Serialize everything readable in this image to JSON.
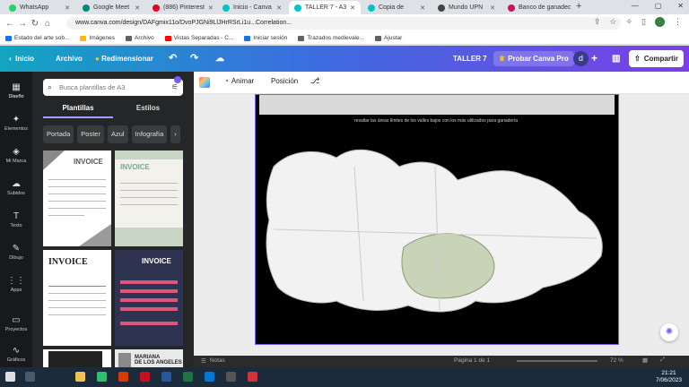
{
  "browser": {
    "tabs": [
      {
        "label": "WhatsApp",
        "color": "#25d366"
      },
      {
        "label": "Google Meet",
        "color": "#00897b"
      },
      {
        "label": "(886) Pinterest",
        "color": "#e60023"
      },
      {
        "label": "Inicio - Canva",
        "color": "#00c4cc"
      },
      {
        "label": "TALLER 7 - A3",
        "color": "#00c4cc"
      },
      {
        "label": "Copia de",
        "color": "#00c4cc"
      },
      {
        "label": "Mundo UPN",
        "color": "#444444"
      },
      {
        "label": "Banco de ganadec",
        "color": "#c2185b"
      }
    ],
    "new_tab": "+",
    "url": "www.canva.com/design/DAFgmix11o/DvoPJGNi9LlJHrRSrLi1u...Correlation...",
    "bookmarks": [
      {
        "label": "Estado del arte sob...",
        "color": "#1a73e8"
      },
      {
        "label": "Imágenes",
        "color": "#fbbc04"
      },
      {
        "label": "Archivo",
        "color": "#5f6368"
      },
      {
        "label": "Vistas Separadas - C...",
        "color": "#ff0000"
      },
      {
        "label": "Iniciar sesión",
        "color": "#1a73e8"
      },
      {
        "label": "Trazados medievale...",
        "color": "#5f6368"
      },
      {
        "label": "Ajustar",
        "color": "#5f6368"
      }
    ]
  },
  "canva": {
    "header": {
      "home": "Inicio",
      "file": "Archivo",
      "resize": "Redimensionar",
      "doc_title": "TALLER 7",
      "upgrade": "Probar Canva Pro",
      "avatar_letter": "d",
      "share": "Compartir"
    },
    "rail": [
      {
        "label": "Diseño",
        "glyph": "▦"
      },
      {
        "label": "Elementos",
        "glyph": "✦"
      },
      {
        "label": "Mi Marca",
        "glyph": "◈"
      },
      {
        "label": "Subidos",
        "glyph": "☁"
      },
      {
        "label": "Texto",
        "glyph": "T"
      },
      {
        "label": "Dibujo",
        "glyph": "✎"
      },
      {
        "label": "Apps",
        "glyph": "⋮⋮"
      },
      {
        "label": "Proyectos",
        "glyph": "▭"
      },
      {
        "label": "Gráficos",
        "glyph": "∿"
      }
    ],
    "panel": {
      "search_placeholder": "Busca plantillas de A3",
      "tabs": [
        "Plantillas",
        "Estilos"
      ],
      "chips": [
        "Portada",
        "Poster",
        "Azul",
        "Infografía"
      ],
      "templates": [
        {
          "title": "INVOICE",
          "color": "#555555"
        },
        {
          "title": "INVOICE",
          "color": "#7aa98a"
        },
        {
          "title": "INVOICE",
          "color": "#222222"
        },
        {
          "title": "INVOICE",
          "color": "#ffffff"
        },
        {
          "title": "",
          "color": "#222222"
        },
        {
          "title": "MARIANA\nDE LOS ANGELES",
          "color": "#222222"
        }
      ]
    },
    "toolbar": {
      "animate": "Animar",
      "position": "Posición"
    },
    "canvas_text": "resaltar las áreas límites de los valles bajos con los más utilizados para ganadería",
    "bottom": {
      "notes": "Notas",
      "page": "Página 1 de 1",
      "zoom": "72 %"
    }
  },
  "taskbar": {
    "time": "21:21",
    "date": "7/06/2023"
  }
}
